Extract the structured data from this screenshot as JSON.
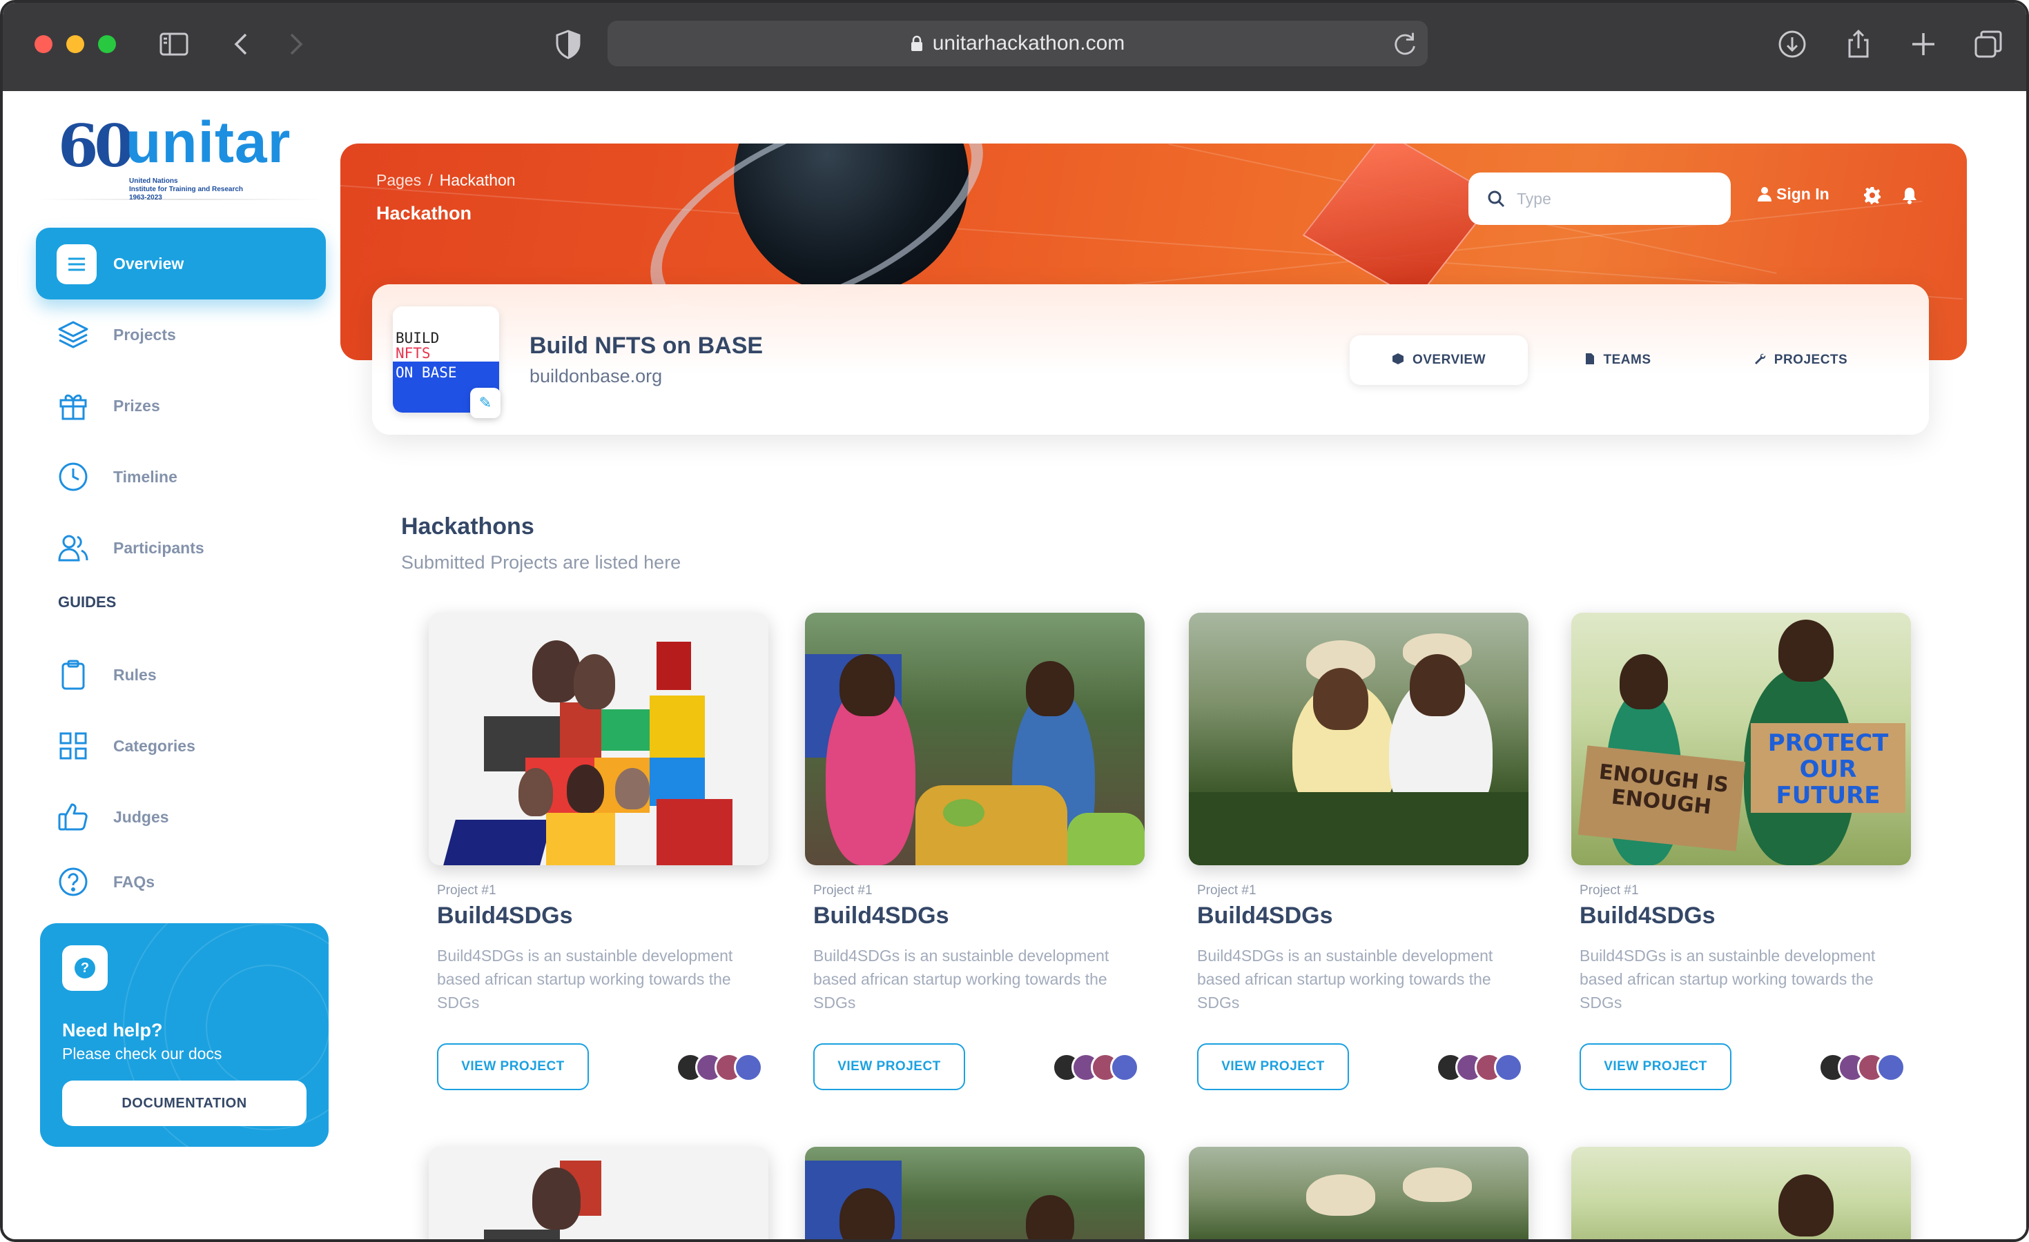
{
  "browser": {
    "url": "unitarhackathon.com"
  },
  "logo": {
    "number": "60",
    "name": "unitar",
    "subtitle": [
      "United Nations",
      "Institute for Training and Research",
      "1963-2023"
    ]
  },
  "sidebar": {
    "items": [
      {
        "label": "Overview",
        "icon": "list-icon",
        "active": true
      },
      {
        "label": "Projects",
        "icon": "layers-icon"
      },
      {
        "label": "Prizes",
        "icon": "gift-icon"
      },
      {
        "label": "Timeline",
        "icon": "clock-icon"
      },
      {
        "label": "Participants",
        "icon": "users-icon"
      }
    ],
    "guides_title": "GUIDES",
    "guides": [
      {
        "label": "Rules",
        "icon": "clipboard-icon"
      },
      {
        "label": "Categories",
        "icon": "grid-icon"
      },
      {
        "label": "Judges",
        "icon": "thumbs-up-icon"
      },
      {
        "label": "FAQs",
        "icon": "question-icon"
      }
    ],
    "help": {
      "icon_glyph": "?",
      "title": "Need help?",
      "subtitle": "Please check our docs",
      "button": "DOCUMENTATION"
    }
  },
  "header": {
    "breadcrumb": [
      "Pages",
      "Hackathon"
    ],
    "breadcrumb_sep": "/",
    "title": "Hackathon",
    "search_placeholder": "Type",
    "signin": "Sign In"
  },
  "profile": {
    "avatar_text": [
      "BUILD",
      "NFTS",
      "ON BASE"
    ],
    "edit_glyph": "✎",
    "name": "Build NFTS on BASE",
    "url": "buildonbase.org",
    "tabs": [
      {
        "label": "OVERVIEW",
        "active": true
      },
      {
        "label": "TEAMS"
      },
      {
        "label": "PROJECTS"
      }
    ]
  },
  "section": {
    "title": "Hackathons",
    "subtitle": "Submitted Projects are listed here"
  },
  "cards": [
    {
      "kicker": "Project #1",
      "title": "Build4SDGs",
      "description": "Build4SDGs is an sustainble development based african startup working towards the SDGs",
      "button": "VIEW PROJECT",
      "protest_signs": []
    },
    {
      "kicker": "Project #1",
      "title": "Build4SDGs",
      "description": "Build4SDGs is an sustainble development based african startup working towards the SDGs",
      "button": "VIEW PROJECT",
      "protest_signs": []
    },
    {
      "kicker": "Project #1",
      "title": "Build4SDGs",
      "description": "Build4SDGs is an sustainble development based african startup working towards the SDGs",
      "button": "VIEW PROJECT",
      "protest_signs": []
    },
    {
      "kicker": "Project #1",
      "title": "Build4SDGs",
      "description": "Build4SDGs is an sustainble development based african startup working towards the SDGs",
      "button": "VIEW PROJECT",
      "protest_signs": [
        "ENOUGH IS ENOUGH",
        "PROTECT OUR FUTURE"
      ]
    }
  ],
  "colors": {
    "accent": "#1ba1e0",
    "banner": "#e95423",
    "text": "#344767",
    "muted": "#8f99ab"
  }
}
